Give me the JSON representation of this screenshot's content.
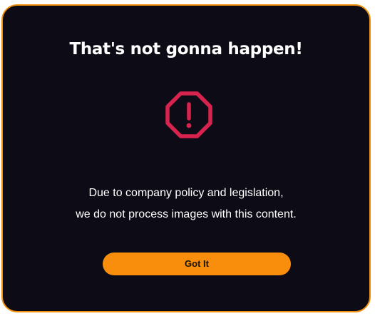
{
  "dialog": {
    "title": "That's not gonna happen!",
    "icon": "octagon-exclamation-icon",
    "message_lines": [
      "Due to company policy and legislation,",
      "we do not process images with this content."
    ],
    "button_label": "Got It"
  },
  "colors": {
    "background": "#0d0c16",
    "border": "#f0900c",
    "icon": "#d8234f",
    "button": "#f88e0b",
    "button_text": "#1a1206",
    "text": "#ffffff"
  }
}
